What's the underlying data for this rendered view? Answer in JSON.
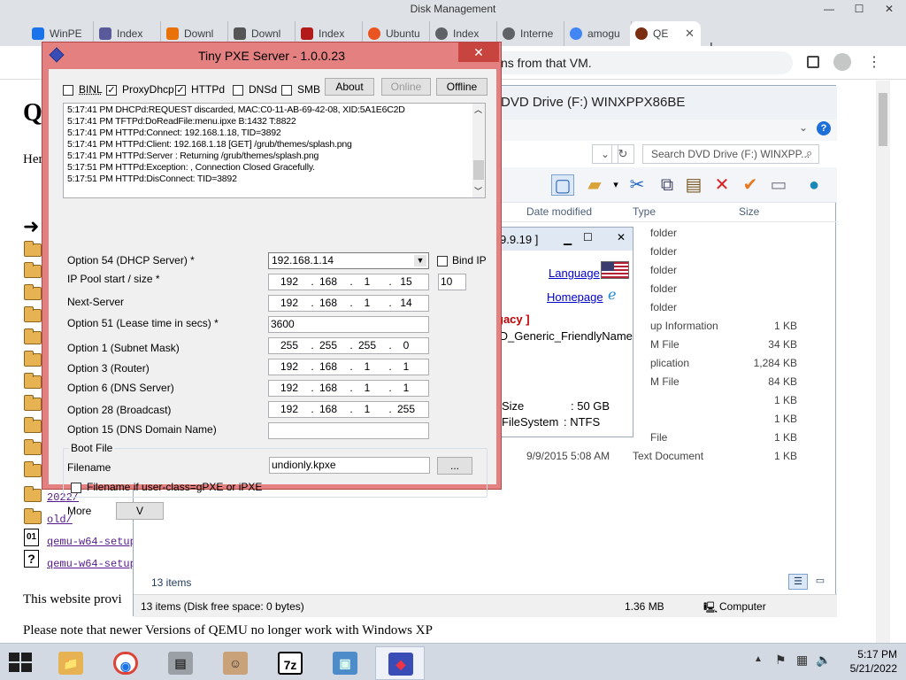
{
  "chrome": {
    "window_title": "Disk Management",
    "min_label": "—",
    "max_label": "☐",
    "close_label": "✕",
    "tabs": [
      {
        "label": "WinPE",
        "color": "#1a73e8"
      },
      {
        "label": "Index",
        "color": "#5a5a9a"
      },
      {
        "label": "Downl",
        "color": "#e8710a"
      },
      {
        "label": "Downl",
        "color": "#555555"
      },
      {
        "label": "Index",
        "color": "#b31b1b"
      },
      {
        "label": "Ubuntu",
        "color": "#e95420"
      },
      {
        "label": "Index",
        "color": "#5f6368"
      },
      {
        "label": "Interne",
        "color": "#5f6368"
      },
      {
        "label": "amogu",
        "color": "#4285f4"
      },
      {
        "label": "QE",
        "color": "#7a2f12"
      }
    ],
    "active_tab_close": "✕",
    "new_tab_label": "+",
    "omnibox_text": "ns from that VM.",
    "page": {
      "heading": "Q",
      "intro": "Her",
      "links": [
        "2022/",
        "old/",
        "qemu-w64-setup",
        "qemu-w64-setup"
      ],
      "bottom_text_1": "This website provi",
      "bottom_text_2": "Please note that newer Versions of QEMU no longer work with Windows XP"
    }
  },
  "explorer": {
    "title": "DVD Drive (F:) WINXPPX86BE",
    "search_placeholder": "Search DVD Drive (F:) WINXPP...",
    "columns": {
      "date": "Date modified",
      "type": "Type",
      "size": "Size"
    },
    "rows": [
      {
        "date": "",
        "type": "folder",
        "size": ""
      },
      {
        "date": "",
        "type": "folder",
        "size": ""
      },
      {
        "date": "",
        "type": "folder",
        "size": ""
      },
      {
        "date": "",
        "type": "folder",
        "size": ""
      },
      {
        "date": "",
        "type": "folder",
        "size": ""
      },
      {
        "date": "",
        "type": "up Information",
        "size": "1 KB"
      },
      {
        "date": "",
        "type": "M File",
        "size": "34 KB"
      },
      {
        "date": "",
        "type": "plication",
        "size": "1,284 KB"
      },
      {
        "date": "",
        "type": "M File",
        "size": "84 KB"
      },
      {
        "date": "",
        "type": "",
        "size": "1 KB"
      },
      {
        "date": "",
        "type": "",
        "size": "1 KB"
      },
      {
        "date": "",
        "type": "File",
        "size": "1 KB"
      },
      {
        "date": "9/9/2015 5:08 AM",
        "type": "Text Document",
        "size": "1 KB"
      }
    ],
    "item_count": "13 items",
    "status_left": "13 items (Disk free space: 0 bytes)",
    "status_size": "1.36 MB",
    "status_location": "Computer"
  },
  "inner_dialog": {
    "title": "9.9.19 ]",
    "language_link": "Language",
    "homepage_link": "Homepage",
    "legacy_text": "gacy ]",
    "friendly_name": "ID_Generic_FriendlyName",
    "size_label": "Size",
    "size_value": ": 50 GB",
    "fs_label": "FileSystem",
    "fs_value": ": NTFS"
  },
  "pxe": {
    "title": "Tiny PXE Server - 1.0.0.23",
    "close_label": "✕",
    "checkboxes": [
      {
        "label": "BINL",
        "checked": false
      },
      {
        "label": "ProxyDhcp",
        "checked": true
      },
      {
        "label": "HTTPd",
        "checked": true
      },
      {
        "label": "DNSd",
        "checked": false
      },
      {
        "label": "SMB",
        "checked": false
      }
    ],
    "about_label": "About",
    "online_label": "Online",
    "offline_label": "Offline",
    "log": [
      "5:17:41 PM DHCPd:REQUEST discarded, MAC:C0-11-AB-69-42-08, XID:5A1E6C2D",
      "5:17:41 PM TFTPd:DoReadFile:menu.ipxe B:1432 T:8822",
      "5:17:41 PM HTTPd:Connect: 192.168.1.18, TID=3892",
      "5:17:41 PM HTTPd:Client: 192.168.1.18 [GET] /grub/themes/splash.png",
      "5:17:41 PM HTTPd:Server : Returning /grub/themes/splash.png",
      "5:17:51 PM HTTPd:Exception: , Connection Closed Gracefully.",
      "5:17:51 PM HTTPd:DisConnect: TID=3892"
    ],
    "option54_label": "Option 54 (DHCP Server) *",
    "option54_value": "192.168.1.14",
    "bind_ip_label": "Bind IP",
    "ip_pool_label": "IP Pool start / size *",
    "ip_pool": [
      "192",
      "168",
      "1",
      "15"
    ],
    "pool_size": "10",
    "next_server_label": "Next-Server",
    "next_server": [
      "192",
      "168",
      "1",
      "14"
    ],
    "option51_label": "Option 51 (Lease time in secs) *",
    "option51_value": "3600",
    "option1_label": "Option 1  (Subnet Mask)",
    "option1": [
      "255",
      "255",
      "255",
      "0"
    ],
    "option3_label": "Option 3  (Router)",
    "option3": [
      "192",
      "168",
      "1",
      "1"
    ],
    "option6_label": "Option 6  (DNS Server)",
    "option6": [
      "192",
      "168",
      "1",
      "1"
    ],
    "option28_label": "Option 28 (Broadcast)",
    "option28": [
      "192",
      "168",
      "1",
      "255"
    ],
    "option15_label": "Option 15 (DNS Domain Name)",
    "option15_value": "",
    "boot_file_group": "Boot File",
    "filename_label": "Filename",
    "filename_value": "undionly.kpxe",
    "browse_label": "...",
    "gpxe_label": "Filename if user-class=gPXE or iPXE",
    "more_label": "More",
    "more_button": "V"
  },
  "taskbar": {
    "time": "5:17 PM",
    "date": "5/21/2022",
    "apps": [
      {
        "name": "File Explorer",
        "glyph": "📁"
      },
      {
        "name": "Chrome",
        "glyph": "◉"
      },
      {
        "name": "Drive tool",
        "glyph": "▤"
      },
      {
        "name": "Support tool",
        "glyph": "☺"
      },
      {
        "name": "7-Zip",
        "glyph": "7z"
      },
      {
        "name": "Image viewer",
        "glyph": "▣"
      },
      {
        "name": "Tiny PXE Server",
        "glyph": "◆"
      }
    ]
  },
  "colors": {
    "pxe_frame": "#e58080",
    "pxe_close": "#c7453e",
    "link": "#551a8b"
  }
}
